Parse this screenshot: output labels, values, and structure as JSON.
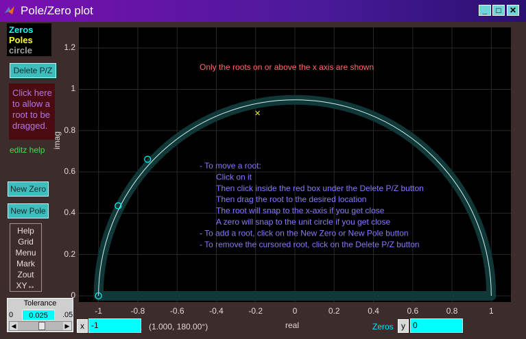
{
  "window": {
    "title": "Pole/Zero plot",
    "minimize": "_",
    "maximize": "□",
    "close": "✕"
  },
  "legend": {
    "zeros": "Zeros",
    "poles": "Poles",
    "circle": "circle",
    "colors": {
      "zeros": "#00ffff",
      "poles": "#ffff20",
      "circle": "#a0a0a0"
    }
  },
  "buttons": {
    "delete_pz": "Delete P/Z",
    "new_zero": "New Zero",
    "new_pole": "New Pole"
  },
  "drag_hint": [
    "Click here",
    "to allow a",
    "root to be",
    "dragged."
  ],
  "editz_help": "editz help",
  "menu_items": [
    "Help",
    "Grid",
    "Menu",
    "Mark",
    "Zout",
    "XY↔"
  ],
  "tolerance": {
    "label": "Tolerance",
    "min": "0",
    "value": "0.025",
    "max": ".05"
  },
  "plot": {
    "notice": "Only the roots on or above the x axis are shown",
    "instructions": [
      "- To move a root:",
      "Click on it",
      "Then click inside the red box under the Delete P/Z button",
      "Then drag the root to the desired location",
      "The root will snap to the x-axis if you get close",
      "A zero will snap to the unit circle if you get close",
      "- To add a root, click on the New Zero or New Pole button",
      "- To remove the cursored root, click on the Delete P/Z button"
    ],
    "xlabel": "real",
    "ylabel": "imag",
    "xticks": [
      "-1",
      "-0.8",
      "-0.6",
      "-0.4",
      "-0.2",
      "0",
      "0.2",
      "0.4",
      "0.6",
      "0.8",
      "1"
    ],
    "yticks": [
      "0",
      "0.2",
      "0.4",
      "0.6",
      "0.8",
      "1",
      "1.2"
    ]
  },
  "chart_data": {
    "type": "scatter",
    "xlim": [
      -1.1,
      1.1
    ],
    "ylim": [
      -0.03,
      1.3
    ],
    "zeros": [
      [
        -1.0,
        0.0
      ],
      [
        -0.9,
        0.436
      ],
      [
        -0.75,
        0.661
      ]
    ],
    "poles": [
      [
        -0.19,
        0.885
      ]
    ],
    "unit_circle": true,
    "grid": true
  },
  "cursor_readout": {
    "x_label": "x",
    "x_value": "-1",
    "coords": "(1.000, 180.00°)",
    "zeros_label": "Zeros",
    "y_label": "y",
    "y_value": "0"
  }
}
